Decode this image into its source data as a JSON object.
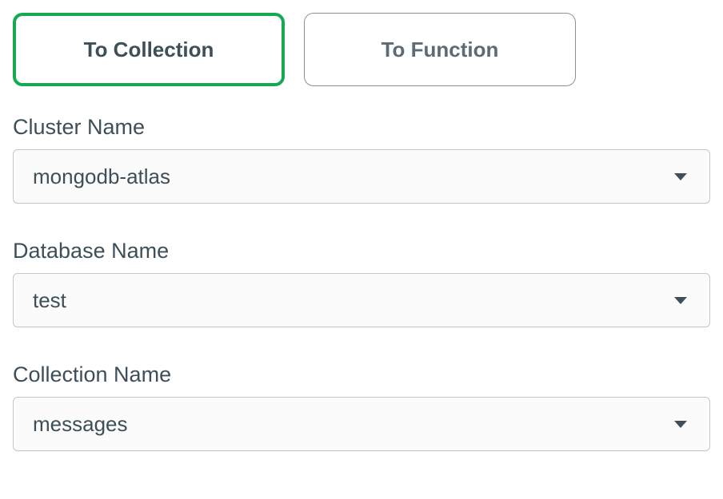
{
  "tabs": {
    "to_collection": "To Collection",
    "to_function": "To Function"
  },
  "fields": {
    "cluster": {
      "label": "Cluster Name",
      "value": "mongodb-atlas"
    },
    "database": {
      "label": "Database Name",
      "value": "test"
    },
    "collection": {
      "label": "Collection Name",
      "value": "messages"
    }
  }
}
